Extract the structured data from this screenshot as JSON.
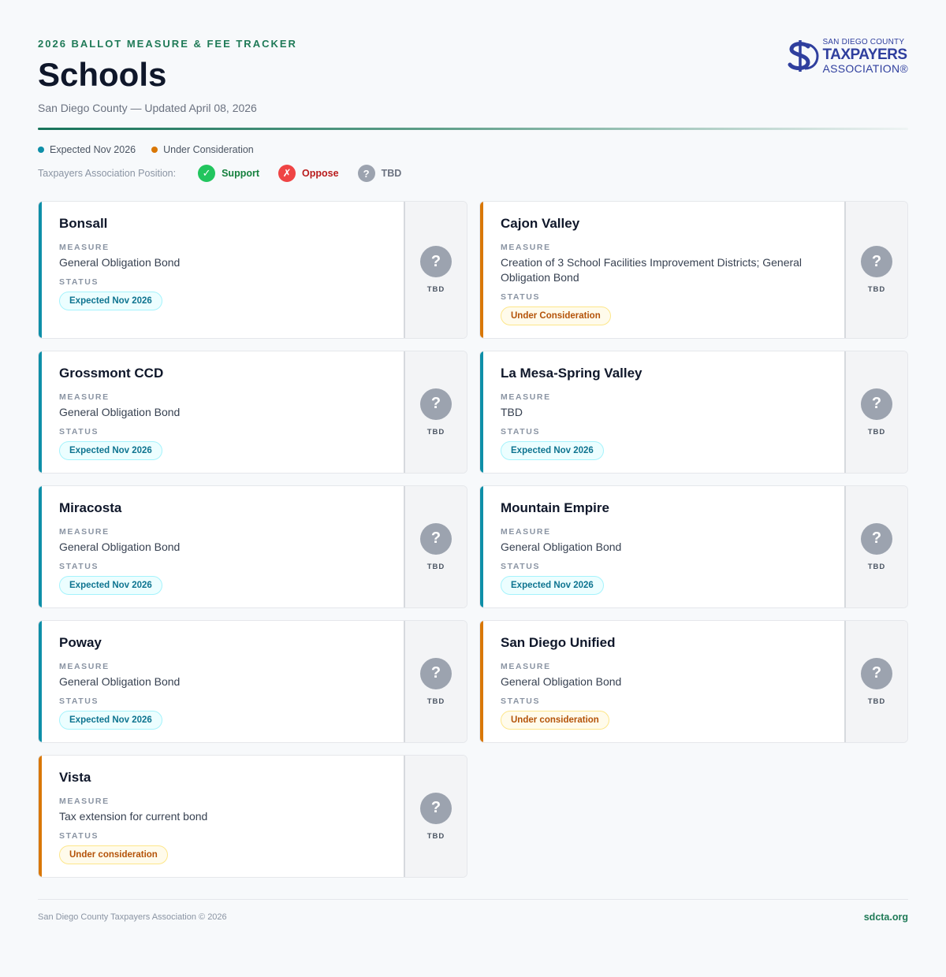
{
  "header": {
    "kicker": "2026 BALLOT MEASURE & FEE TRACKER",
    "title": "Schools",
    "subtitle": "San Diego County — Updated April 08, 2026"
  },
  "logo": {
    "line1": "SAN DIEGO COUNTY",
    "line2": "TAXPAYERS",
    "line3": "ASSOCIATION®",
    "color": "#2f3f9e"
  },
  "legend": [
    {
      "label": "Expected Nov 2026",
      "color": "#0e8fa8"
    },
    {
      "label": "Under Consideration",
      "color": "#d97706"
    }
  ],
  "positions": {
    "label": "Taxpayers Association Position:",
    "items": [
      {
        "label": "Support",
        "icon": "check-icon",
        "glyph": "✓",
        "color": "#22c55e",
        "text_color": "#15803d"
      },
      {
        "label": "Oppose",
        "icon": "x-icon",
        "glyph": "✗",
        "color": "#ef4444",
        "text_color": "#b91c1c"
      },
      {
        "label": "TBD",
        "icon": "question-icon",
        "glyph": "?",
        "color": "#9ca3af",
        "text_color": "#6b7280"
      }
    ]
  },
  "card_labels": {
    "measure": "MEASURE",
    "status": "STATUS"
  },
  "cards": [
    {
      "name": "Bonsall",
      "measure": "General Obligation Bond",
      "status": "Expected Nov 2026",
      "status_type": "teal",
      "position": "TBD"
    },
    {
      "name": "Cajon Valley",
      "measure": "Creation of 3 School Facilities Improvement Districts; General Obligation Bond",
      "status": "Under Consideration",
      "status_type": "amber",
      "position": "TBD"
    },
    {
      "name": "Grossmont CCD",
      "measure": "General Obligation Bond",
      "status": "Expected Nov 2026",
      "status_type": "teal",
      "position": "TBD"
    },
    {
      "name": "La Mesa-Spring Valley",
      "measure": "TBD",
      "status": "Expected Nov 2026",
      "status_type": "teal",
      "position": "TBD"
    },
    {
      "name": "Miracosta",
      "measure": "General Obligation Bond",
      "status": "Expected Nov 2026",
      "status_type": "teal",
      "position": "TBD"
    },
    {
      "name": "Mountain Empire",
      "measure": "General Obligation Bond",
      "status": "Expected Nov 2026",
      "status_type": "teal",
      "position": "TBD"
    },
    {
      "name": "Poway",
      "measure": "General Obligation Bond",
      "status": "Expected Nov 2026",
      "status_type": "teal",
      "position": "TBD"
    },
    {
      "name": "San Diego Unified",
      "measure": "General Obligation Bond",
      "status": "Under consideration",
      "status_type": "amber",
      "position": "TBD"
    },
    {
      "name": "Vista",
      "measure": "Tax extension for current bond",
      "status": "Under consideration",
      "status_type": "amber",
      "position": "TBD"
    }
  ],
  "status_colors": {
    "teal": "#0e8fa8",
    "amber": "#d97706"
  },
  "footer": {
    "left": "San Diego County Taxpayers Association © 2026",
    "right": "sdcta.org"
  }
}
